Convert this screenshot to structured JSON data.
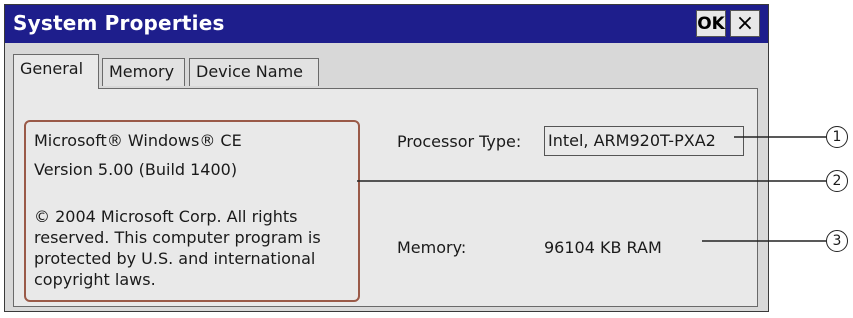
{
  "window": {
    "title": "System Properties",
    "ok_label": "OK",
    "close_label": "×"
  },
  "tabs": [
    {
      "label": "General",
      "active": true
    },
    {
      "label": "Memory",
      "active": false
    },
    {
      "label": "Device Name",
      "active": false
    }
  ],
  "general": {
    "os_name": "Microsoft® Windows® CE",
    "version": "Version 5.00 (Build 1400)",
    "copyright": "© 2004 Microsoft Corp. All rights reserved. This computer program is protected by U.S. and international copyright laws.",
    "processor_label": "Processor Type:",
    "processor_value": "Intel, ARM920T-PXA2",
    "memory_label": "Memory:",
    "memory_value": "96104 KB  RAM"
  },
  "callouts": [
    "1",
    "2",
    "3"
  ],
  "colors": {
    "titlebar": "#1e1e8c",
    "highlight_border": "#9a5a48",
    "panel": "#e9e9e9"
  }
}
